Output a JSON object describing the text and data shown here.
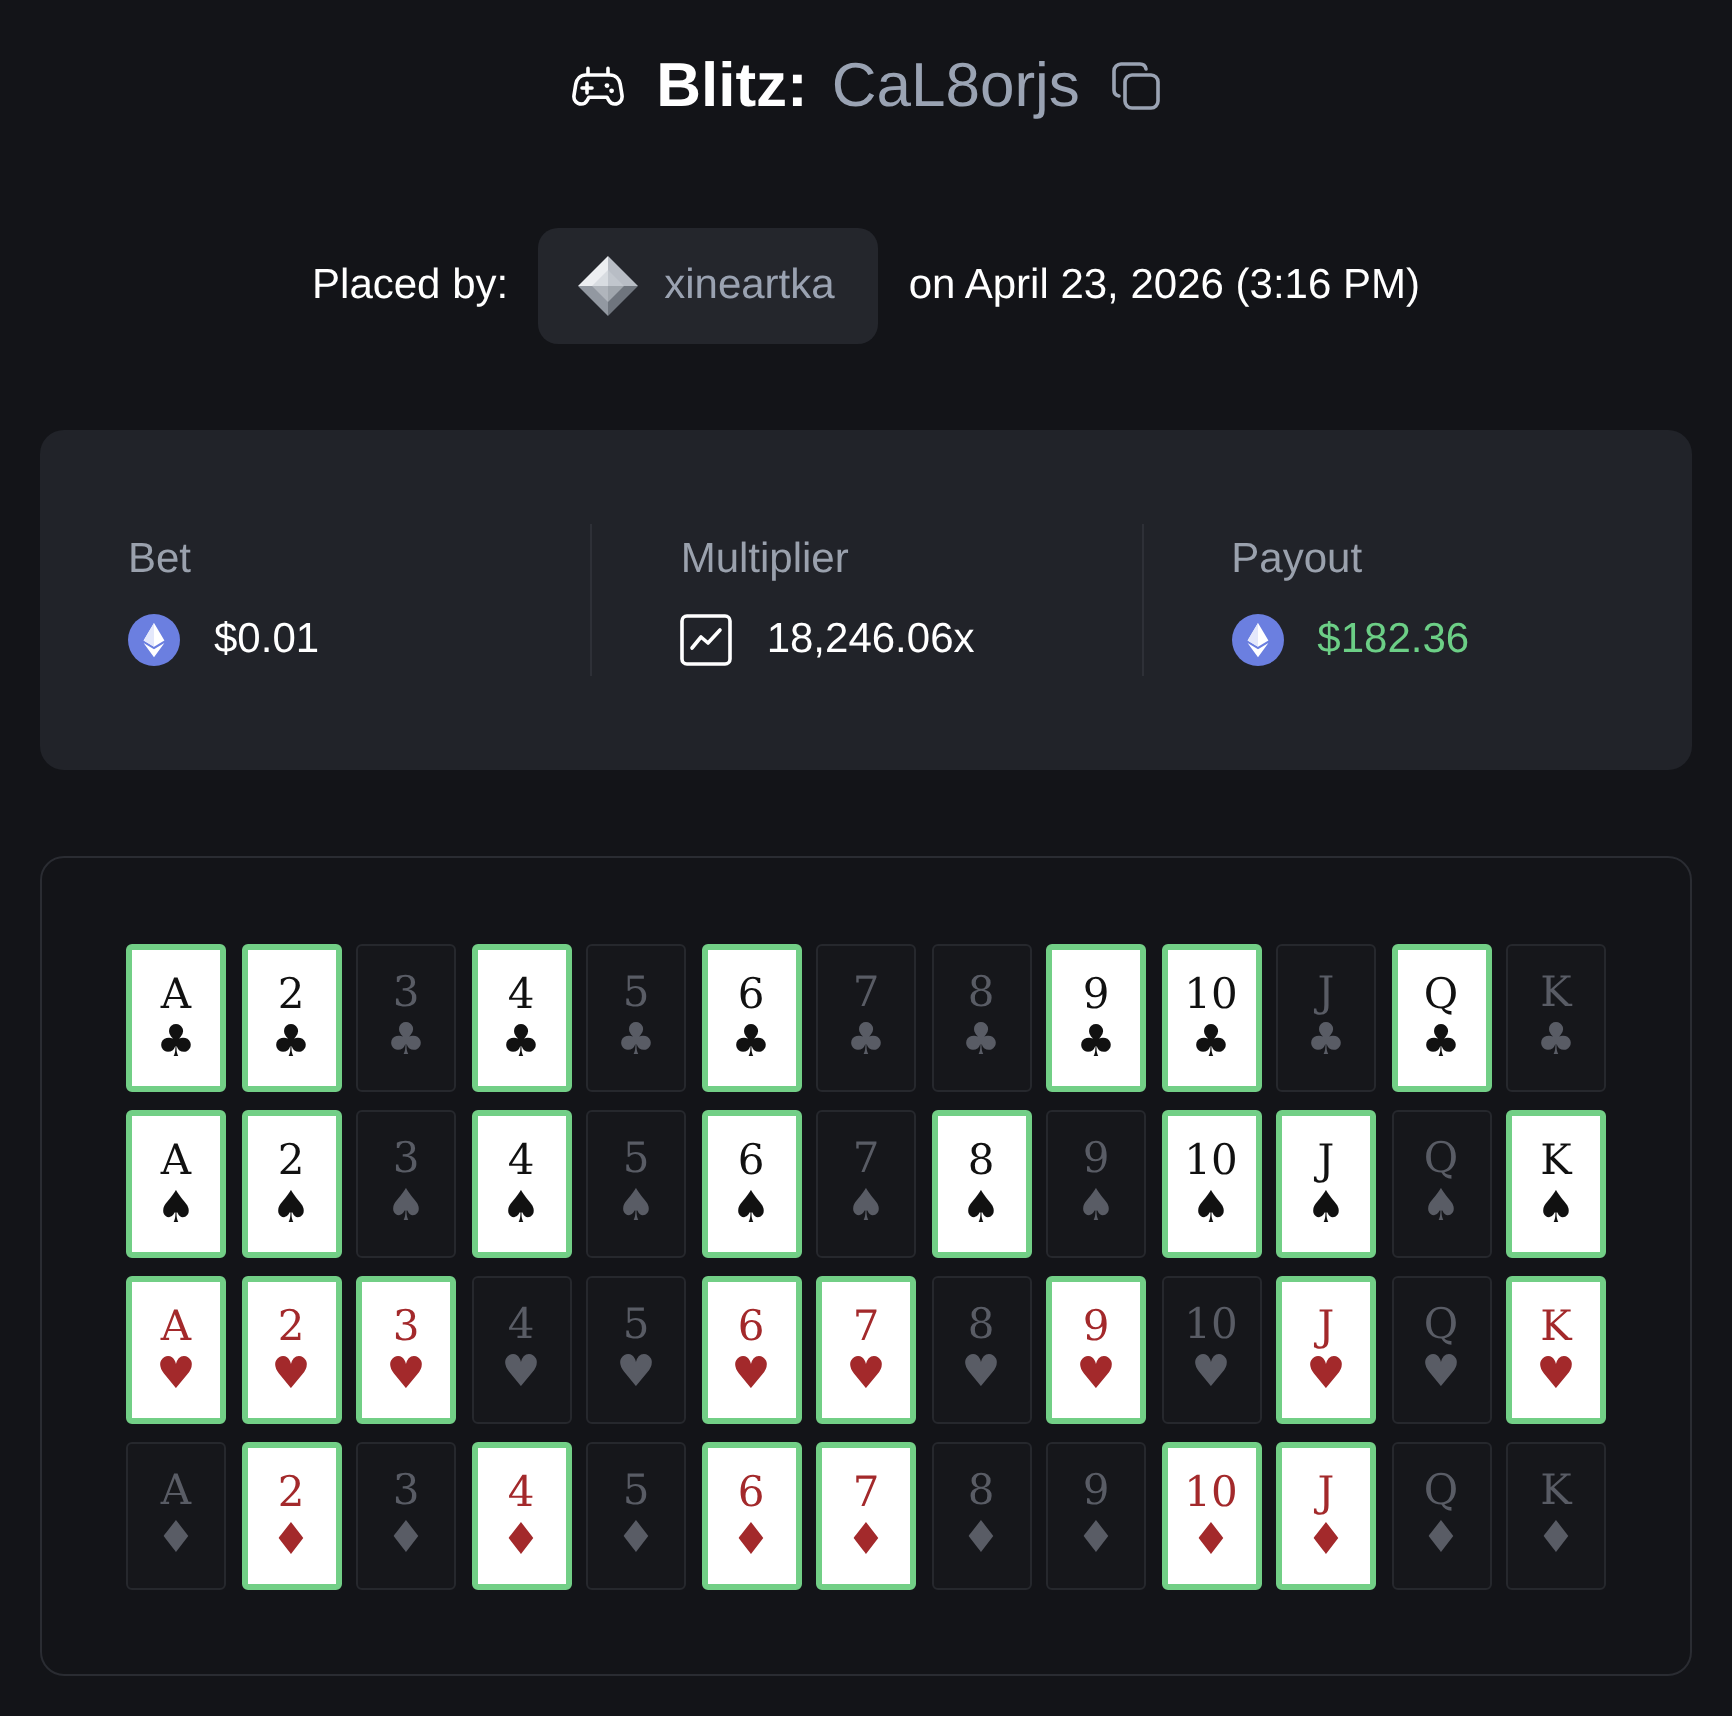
{
  "title": {
    "game": "Blitz:",
    "code": "CaL8orjs"
  },
  "placed_by": {
    "label": "Placed by:",
    "user": "xineartka",
    "date": "on April 23, 2026 (3:16 PM)"
  },
  "stats": [
    {
      "kind": "bet",
      "label": "Bet",
      "value": "$0.01"
    },
    {
      "kind": "multiplier",
      "label": "Multiplier",
      "value": "18,246.06x"
    },
    {
      "kind": "payout",
      "label": "Payout",
      "value": "$182.36"
    }
  ],
  "board": {
    "rows": [
      {
        "color": "#111111",
        "cards": [
          {
            "rank": "A",
            "suit": "♣",
            "selected": true
          },
          {
            "rank": "2",
            "suit": "♣",
            "selected": true
          },
          {
            "rank": "3",
            "suit": "♣",
            "selected": false
          },
          {
            "rank": "4",
            "suit": "♣",
            "selected": true
          },
          {
            "rank": "5",
            "suit": "♣",
            "selected": false
          },
          {
            "rank": "6",
            "suit": "♣",
            "selected": true
          },
          {
            "rank": "7",
            "suit": "♣",
            "selected": false
          },
          {
            "rank": "8",
            "suit": "♣",
            "selected": false
          },
          {
            "rank": "9",
            "suit": "♣",
            "selected": true
          },
          {
            "rank": "10",
            "suit": "♣",
            "selected": true
          },
          {
            "rank": "J",
            "suit": "♣",
            "selected": false
          },
          {
            "rank": "Q",
            "suit": "♣",
            "selected": true
          },
          {
            "rank": "K",
            "suit": "♣",
            "selected": false
          }
        ]
      },
      {
        "color": "#111111",
        "cards": [
          {
            "rank": "A",
            "suit": "♠",
            "selected": true
          },
          {
            "rank": "2",
            "suit": "♠",
            "selected": true
          },
          {
            "rank": "3",
            "suit": "♠",
            "selected": false
          },
          {
            "rank": "4",
            "suit": "♠",
            "selected": true
          },
          {
            "rank": "5",
            "suit": "♠",
            "selected": false
          },
          {
            "rank": "6",
            "suit": "♠",
            "selected": true
          },
          {
            "rank": "7",
            "suit": "♠",
            "selected": false
          },
          {
            "rank": "8",
            "suit": "♠",
            "selected": true
          },
          {
            "rank": "9",
            "suit": "♠",
            "selected": false
          },
          {
            "rank": "10",
            "suit": "♠",
            "selected": true
          },
          {
            "rank": "J",
            "suit": "♠",
            "selected": true
          },
          {
            "rank": "Q",
            "suit": "♠",
            "selected": false
          },
          {
            "rank": "K",
            "suit": "♠",
            "selected": true
          }
        ]
      },
      {
        "color": "#a3292b",
        "cards": [
          {
            "rank": "A",
            "suit": "♥",
            "selected": true
          },
          {
            "rank": "2",
            "suit": "♥",
            "selected": true
          },
          {
            "rank": "3",
            "suit": "♥",
            "selected": true
          },
          {
            "rank": "4",
            "suit": "♥",
            "selected": false
          },
          {
            "rank": "5",
            "suit": "♥",
            "selected": false
          },
          {
            "rank": "6",
            "suit": "♥",
            "selected": true
          },
          {
            "rank": "7",
            "suit": "♥",
            "selected": true
          },
          {
            "rank": "8",
            "suit": "♥",
            "selected": false
          },
          {
            "rank": "9",
            "suit": "♥",
            "selected": true
          },
          {
            "rank": "10",
            "suit": "♥",
            "selected": false
          },
          {
            "rank": "J",
            "suit": "♥",
            "selected": true
          },
          {
            "rank": "Q",
            "suit": "♥",
            "selected": false
          },
          {
            "rank": "K",
            "suit": "♥",
            "selected": true
          }
        ]
      },
      {
        "color": "#a3292b",
        "cards": [
          {
            "rank": "A",
            "suit": "♦",
            "selected": false
          },
          {
            "rank": "2",
            "suit": "♦",
            "selected": true
          },
          {
            "rank": "3",
            "suit": "♦",
            "selected": false
          },
          {
            "rank": "4",
            "suit": "♦",
            "selected": true
          },
          {
            "rank": "5",
            "suit": "♦",
            "selected": false
          },
          {
            "rank": "6",
            "suit": "♦",
            "selected": true
          },
          {
            "rank": "7",
            "suit": "♦",
            "selected": true
          },
          {
            "rank": "8",
            "suit": "♦",
            "selected": false
          },
          {
            "rank": "9",
            "suit": "♦",
            "selected": false
          },
          {
            "rank": "10",
            "suit": "♦",
            "selected": true
          },
          {
            "rank": "J",
            "suit": "♦",
            "selected": true
          },
          {
            "rank": "Q",
            "suit": "♦",
            "selected": false
          },
          {
            "rank": "K",
            "suit": "♦",
            "selected": false
          }
        ]
      }
    ]
  }
}
